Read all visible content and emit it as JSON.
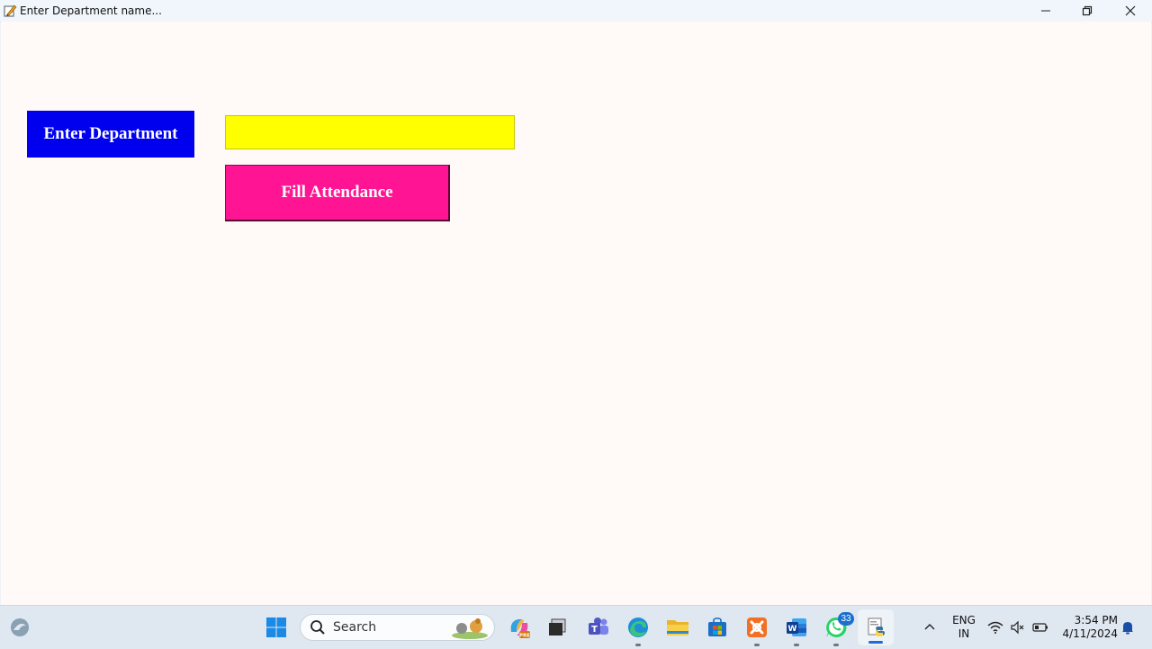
{
  "window": {
    "title": "Enter Department name..."
  },
  "form": {
    "department_label": "Enter Department",
    "department_value": "",
    "fill_button_label": "Fill Attendance"
  },
  "colors": {
    "label_bg": "#0000ee",
    "input_bg": "#ffff00",
    "button_bg": "#ff1493",
    "client_bg": "#fff9f8"
  },
  "taskbar": {
    "search_placeholder": "Search",
    "whatsapp_badge": "33",
    "language_line1": "ENG",
    "language_line2": "IN",
    "time": "3:54 PM",
    "date": "4/11/2024",
    "apps": [
      "widgets-icon",
      "start-icon",
      "search-icon",
      "copilot-icon",
      "task-view-icon",
      "teams-icon",
      "edge-icon",
      "file-explorer-icon",
      "store-icon",
      "xampp-icon",
      "word-icon",
      "whatsapp-icon",
      "python-icon"
    ]
  }
}
